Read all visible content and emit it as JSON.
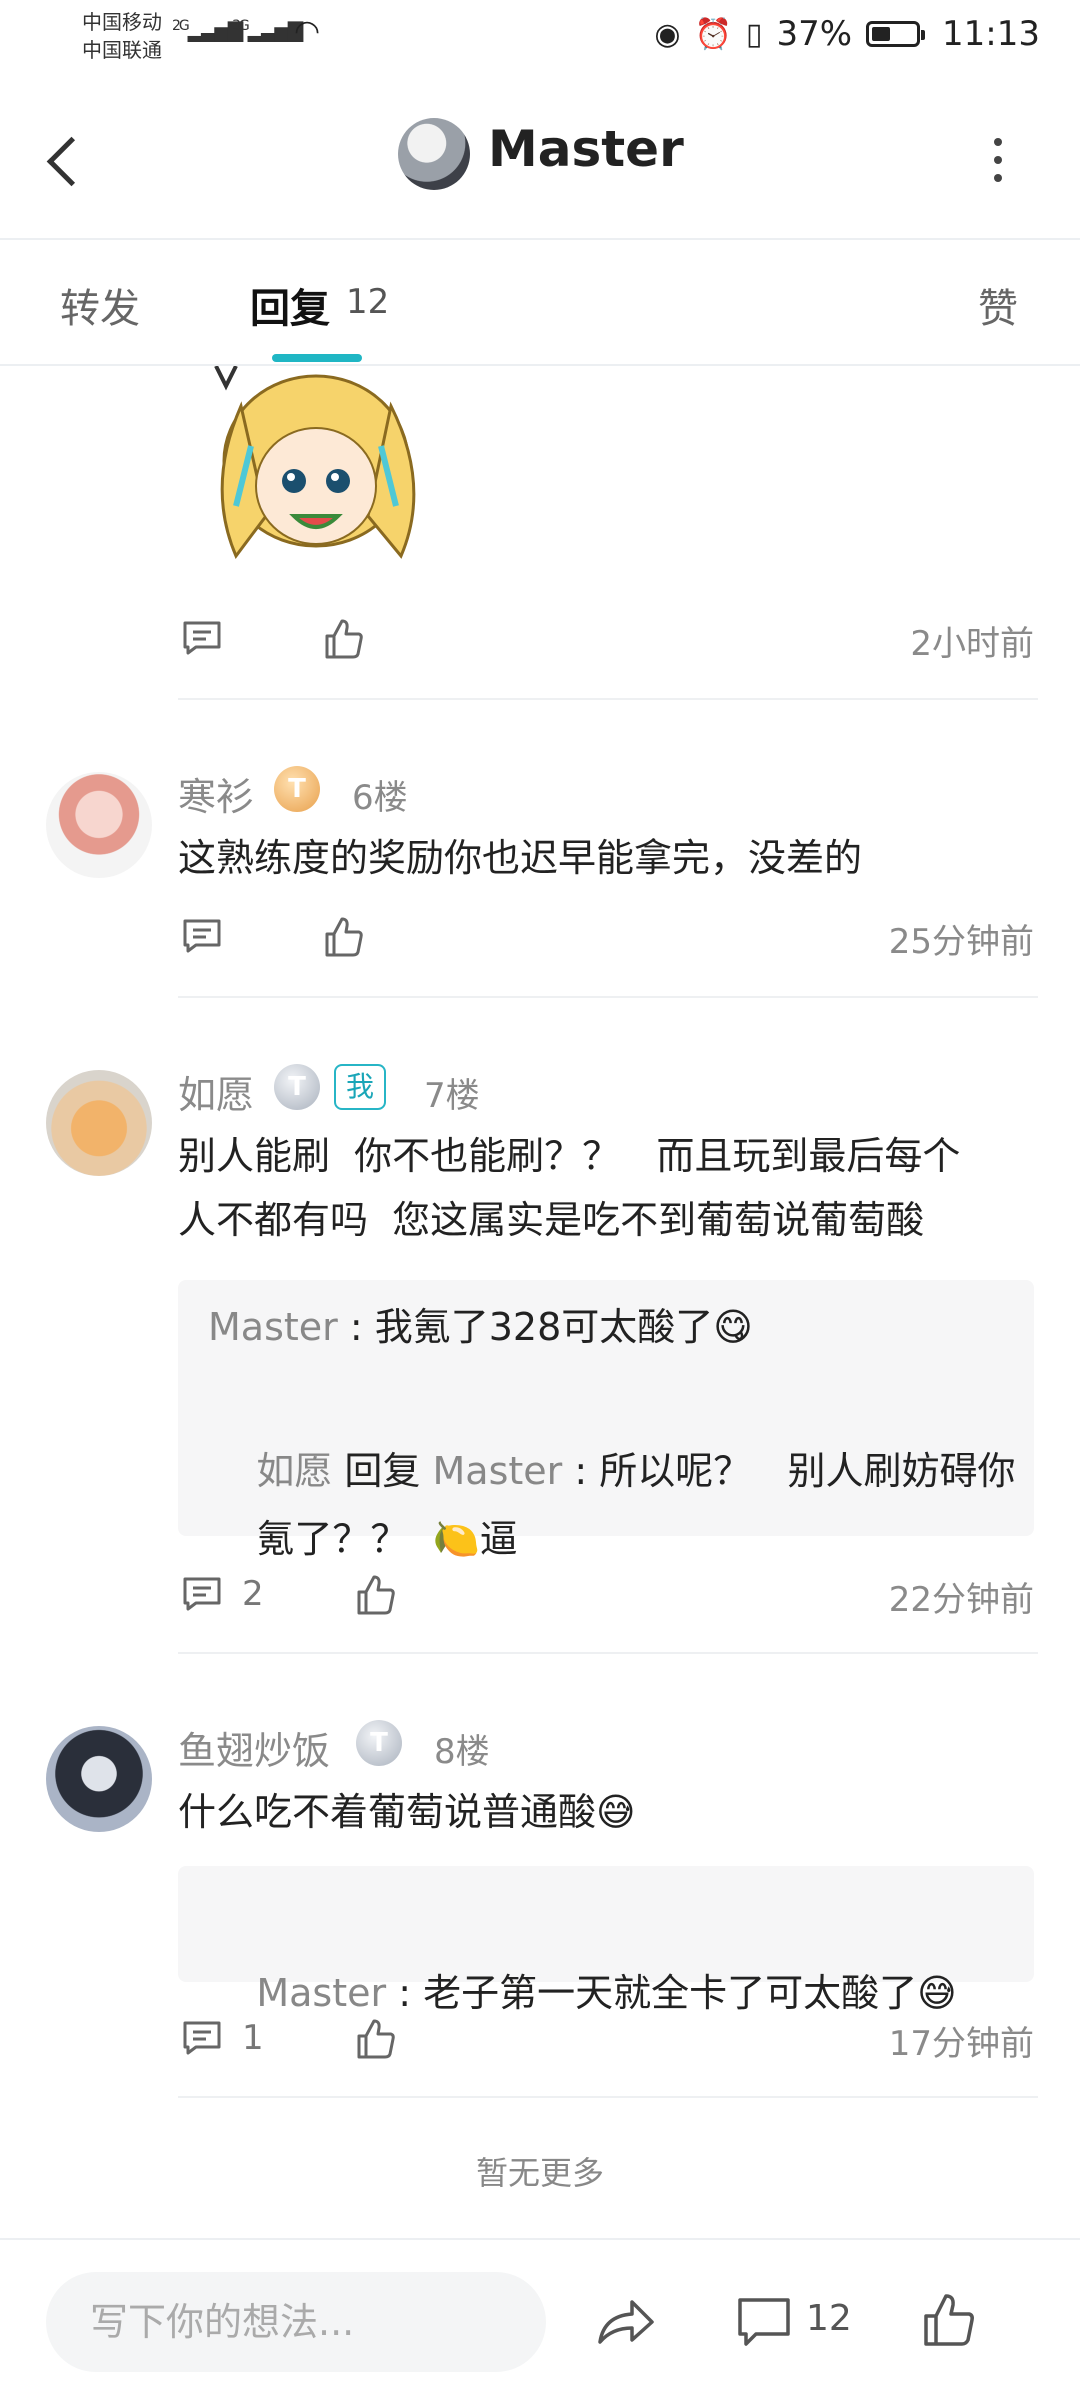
{
  "status_bar": {
    "carrier1": "中国移动",
    "carrier2": "中国联通",
    "net1": "2G",
    "net2": "3G",
    "battery": "37%",
    "time": "11:13"
  },
  "header": {
    "title": "Master"
  },
  "tabs": {
    "forward": "转发",
    "reply": "回复",
    "reply_count": "12",
    "like": "赞"
  },
  "first_item": {
    "time": "2小时前"
  },
  "comments": [
    {
      "nick": "寒衫",
      "badge": "T",
      "floor": "6楼",
      "text": "这熟练度的奖励你也迟早能拿完，没差的",
      "time": "25分钟前"
    },
    {
      "nick": "如愿",
      "badge": "T",
      "me": "我",
      "floor": "7楼",
      "text1": "别人能刷  你不也能刷？？   而且玩到最后每个",
      "text2": "人不都有吗  您这属实是吃不到葡萄说葡萄酸",
      "quote": [
        {
          "name": "Master",
          "sep": " : ",
          "text": "我氪了328可太酸了😋"
        },
        {
          "name": "如愿",
          "mid": " 回复 ",
          "target": "Master",
          "sep": " : ",
          "text": "所以呢？   别人刷妨碍你"
        },
        {
          "text": "氪了？？  🍋逼"
        }
      ],
      "reply_count": "2",
      "time": "22分钟前"
    },
    {
      "nick": "鱼翅炒饭",
      "badge": "T",
      "floor": "8楼",
      "text": "什么吃不着葡萄说普通酸😅",
      "quote": [
        {
          "name": "Master",
          "sep": " : ",
          "text": "老子第一天就全卡了可太酸了😅"
        }
      ],
      "reply_count": "1",
      "time": "17分钟前"
    }
  ],
  "no_more": "暂无更多",
  "bottom": {
    "placeholder": "写下你的想法...",
    "comment_count": "12"
  },
  "colors": {
    "accent": "#1fb6c4",
    "gray_text": "#8a8a8a"
  }
}
